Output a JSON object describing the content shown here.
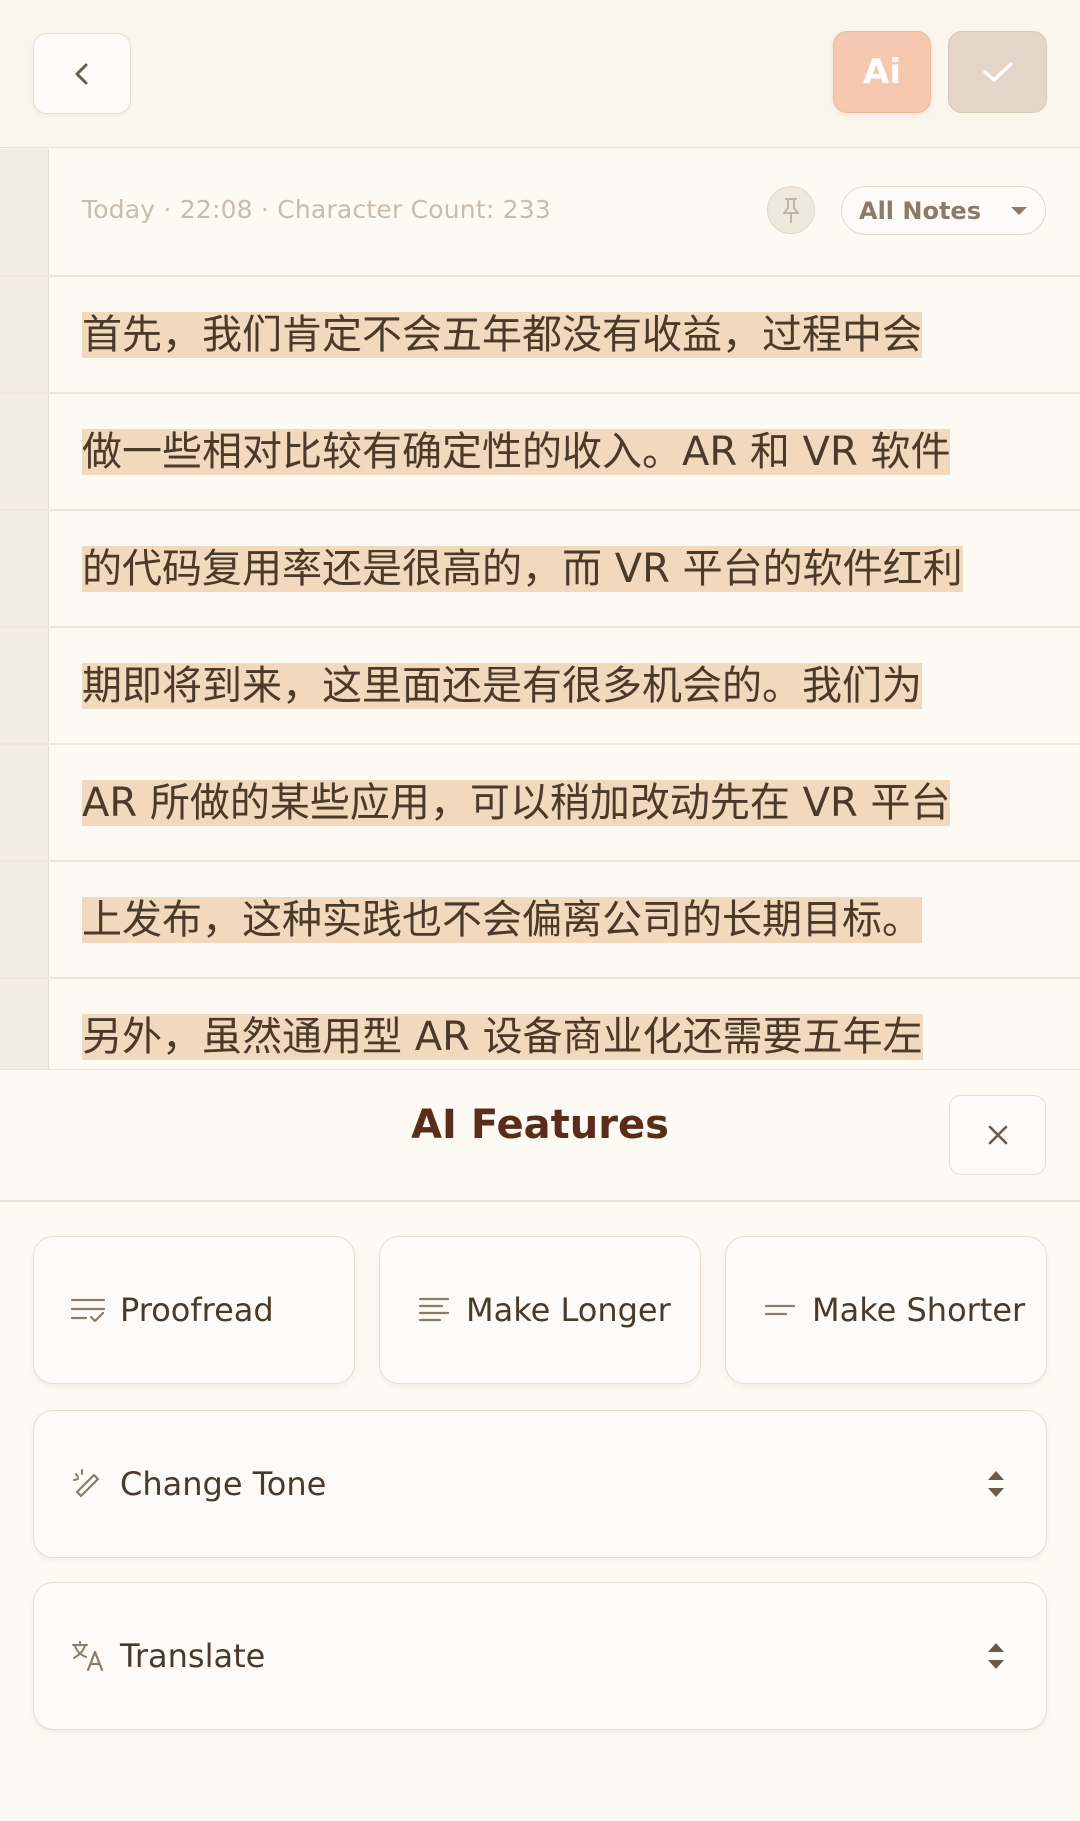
{
  "header": {
    "back_icon": "chevron-left-icon",
    "ai_label": "Ai",
    "confirm_icon": "check-icon",
    "colors": {
      "ai_button": "#f6c8b0",
      "confirm_button": "#e3d6c8"
    }
  },
  "note": {
    "meta": "Today · 22:08 · Character Count: 233",
    "pin_icon": "pin-icon",
    "folder_label": "All Notes",
    "lines": [
      "首先，我们肯定不会五年都没有收益，过程中会",
      "做一些相对比较有确定性的收入。AR 和 VR 软件",
      "的代码复用率还是很高的，而 VR 平台的软件红利",
      "期即将到来，这里面还是有很多机会的。我们为",
      "AR 所做的某些应用，可以稍加改动先在 VR 平台",
      "上发布，这种实践也不会偏离公司的长期目标。",
      "另外，虽然通用型 AR 设备商业化还需要五年左"
    ],
    "highlight_color": "#f2d8bd"
  },
  "ai_panel": {
    "title": "AI Features",
    "close_icon": "close-icon",
    "actions": [
      {
        "label": "Proofread",
        "icon": "proofread-icon"
      },
      {
        "label": "Make Longer",
        "icon": "make-longer-icon"
      },
      {
        "label": "Make Shorter",
        "icon": "make-shorter-icon"
      }
    ],
    "change_tone": {
      "label": "Change Tone",
      "icon": "magic-pen-icon"
    },
    "translate": {
      "label": "Translate",
      "icon": "translate-icon"
    }
  }
}
